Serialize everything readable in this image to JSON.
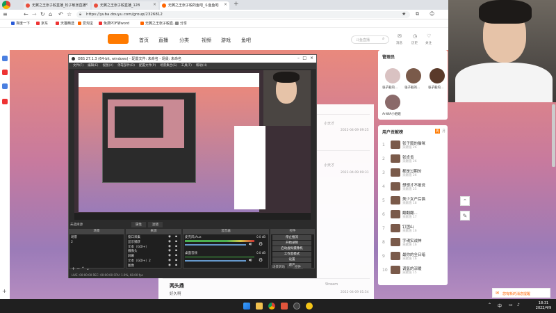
{
  "tabs": [
    {
      "title": "无翼之王张子毅直播_松子敏张直播"
    },
    {
      "title": "无翼之王张子毅直播_12B"
    },
    {
      "title": "无翼之王张子毅的鱼吧_斗鱼鱼吧"
    }
  ],
  "address": {
    "url": "https://yuba.douyu.com/group/2326812"
  },
  "bookmarks": [
    "百度一下",
    "京东",
    "天猫精选",
    "爱淘宝",
    "免费PDF转word",
    "无翼之王张子毅直...",
    "分享"
  ],
  "site": {
    "nav": [
      "首页",
      "直播",
      "分类",
      "视频",
      "游戏",
      "鱼吧"
    ],
    "search_placeholder": "斗鱼直播",
    "header_icons": [
      "消息",
      "历史",
      "关注",
      "下载"
    ]
  },
  "admins": {
    "title": "管理员",
    "more": "全部",
    "names": [
      "张子毅的...",
      "张子毅的...",
      "张子毅的...",
      "AnWA小姐姐"
    ]
  },
  "rank": {
    "title": "用户贡献榜",
    "tabs": [
      "周",
      "月"
    ],
    "rows": [
      {
        "num": "1",
        "name": "张子毅的猫咪",
        "sub": "贡献值 26"
      },
      {
        "num": "2",
        "name": "张肯肯",
        "sub": "贡献值 26"
      },
      {
        "num": "3",
        "name": "都是过期的",
        "sub": "贡献值 26"
      },
      {
        "num": "4",
        "name": "想想才不敢说",
        "sub": "贡献值 25"
      },
      {
        "num": "5",
        "name": "美少女产后猫",
        "sub": "贡献值 18"
      },
      {
        "num": "6",
        "name": "翻翻翻...",
        "sub": "贡献值 17"
      },
      {
        "num": "7",
        "name": "钉团山",
        "sub": "贡献值 16"
      },
      {
        "num": "8",
        "name": "字魂实战神",
        "sub": "贡献值 16"
      },
      {
        "num": "9",
        "name": "最你的全日暗",
        "sub": "贡献值 16"
      },
      {
        "num": "10",
        "name": "调氢的深暖",
        "sub": "贡献值 15"
      }
    ]
  },
  "feed": {
    "rows": [
      {
        "name": "小天才",
        "time": "2022-04-09 09:25"
      },
      {
        "name": "小天才",
        "time": "2022-04-09 09:31"
      },
      {
        "name": "Stream",
        "time": "2022-04-09 01:54"
      }
    ],
    "post_title": "两头鼎",
    "post_body": "好久啊"
  },
  "obs": {
    "title": "OBS 27.1.3 (64-bit, windows) - 配置文件: 未命名 - 场景: 未命名",
    "menu": [
      "文件(F)",
      "编辑(E)",
      "视图(V)",
      "停靠部件(D)",
      "配置文件(P)",
      "场景集合(S)",
      "工具(T)",
      "帮助(H)"
    ],
    "filter_label": "未选择源",
    "props_btn": "属性",
    "filter_btn": "滤镜",
    "docks": {
      "scenes": "场景",
      "sources": "来源",
      "mixer": "混音器",
      "controls": "控件"
    },
    "scenes": [
      "场景",
      "2"
    ],
    "sources": [
      "窗口采集",
      "显示捕获",
      "文本（GDI+）",
      "摄像头",
      "屏幕",
      "文本（GDI+）2",
      "图像"
    ],
    "mixer": [
      {
        "name": "麦克风/Aux",
        "db": "0.0 dB"
      },
      {
        "name": "桌面音频",
        "db": "0.0 dB"
      }
    ],
    "controls": [
      "停止推流",
      "开始录制",
      "启动虚拟摄像机",
      "工作室模式",
      "设置",
      "退出"
    ],
    "bottom_tabs": [
      "场景转场",
      "控件"
    ],
    "status": "LIVE: 00:00:00   REC: 00:00:00   CPU: 1.9%, 60.00 fps"
  },
  "taskbar": {
    "time": "18:31",
    "date": "2022/4/9",
    "ime": "中"
  },
  "toast": {
    "text": "您有新的消息提醒"
  }
}
